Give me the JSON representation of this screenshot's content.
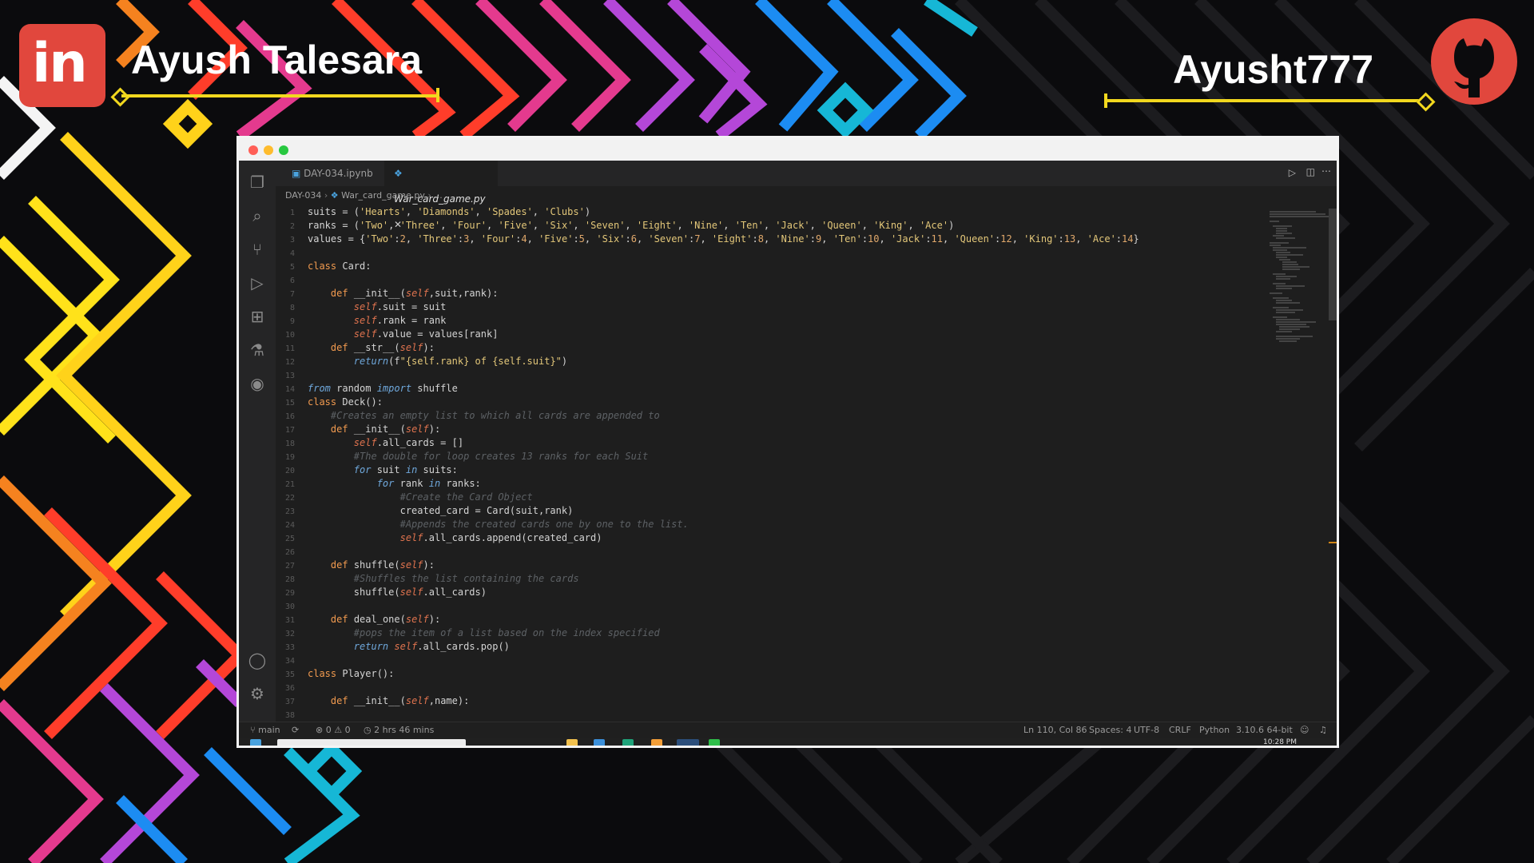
{
  "banner": {
    "left_name": "Ayush Talesara",
    "left_logo": "in",
    "right_name": "Ayusht777",
    "right_logo": "github-icon"
  },
  "window": {
    "traffic_lights": [
      "#ff5f57",
      "#febc2e",
      "#28c840"
    ],
    "tabs": [
      {
        "label": "DAY-034.ipynb",
        "active": false
      },
      {
        "label": "War_card_game.py",
        "active": true,
        "close": "✕"
      }
    ],
    "breadcrumb": [
      "DAY-034",
      "War_card_game.py",
      "..."
    ],
    "lines": [
      "suits = ('Hearts', 'Diamonds', 'Spades', 'Clubs')",
      "ranks = ('Two', 'Three', 'Four', 'Five', 'Six', 'Seven', 'Eight', 'Nine', 'Ten', 'Jack', 'Queen', 'King', 'Ace')",
      "values = {'Two':2, 'Three':3, 'Four':4, 'Five':5, 'Six':6, 'Seven':7, 'Eight':8, 'Nine':9, 'Ten':10, 'Jack':11, 'Queen':12, 'King':13, 'Ace':14}",
      "",
      "class Card:",
      "",
      "    def __init__(self,suit,rank):",
      "        self.suit = suit",
      "        self.rank = rank",
      "        self.value = values[rank]",
      "    def __str__(self):",
      "        return(f\"{self.rank} of {self.suit}\")",
      "",
      "from random import shuffle",
      "class Deck():",
      "    #Creates an empty list to which all cards are appended to",
      "    def __init__(self):",
      "        self.all_cards = []",
      "        #The double for loop creates 13 ranks for each Suit",
      "        for suit in suits:",
      "            for rank in ranks:",
      "                #Create the Card Object",
      "                created_card = Card(suit,rank)",
      "                #Appends the created cards one by one to the list.",
      "                self.all_cards.append(created_card)",
      "",
      "    def shuffle(self):",
      "        #Shuffles the list containing the cards",
      "        shuffle(self.all_cards)",
      "",
      "    def deal_one(self):",
      "        #pops the item of a list based on the index specified",
      "        return self.all_cards.pop()",
      "",
      "class Player():",
      "",
      "    def __init__(self,name):",
      ""
    ],
    "status": {
      "branch": "main",
      "problems": "⊗ 0 ⚠ 0",
      "time": "2 hrs 46 mins",
      "position": "Ln 110, Col 86",
      "spaces": "Spaces: 4",
      "encoding": "UTF-8",
      "eol": "CRLF",
      "language": "Python",
      "interpreter": "3.10.6 64-bit"
    },
    "taskbar_time": "10:28 PM"
  }
}
